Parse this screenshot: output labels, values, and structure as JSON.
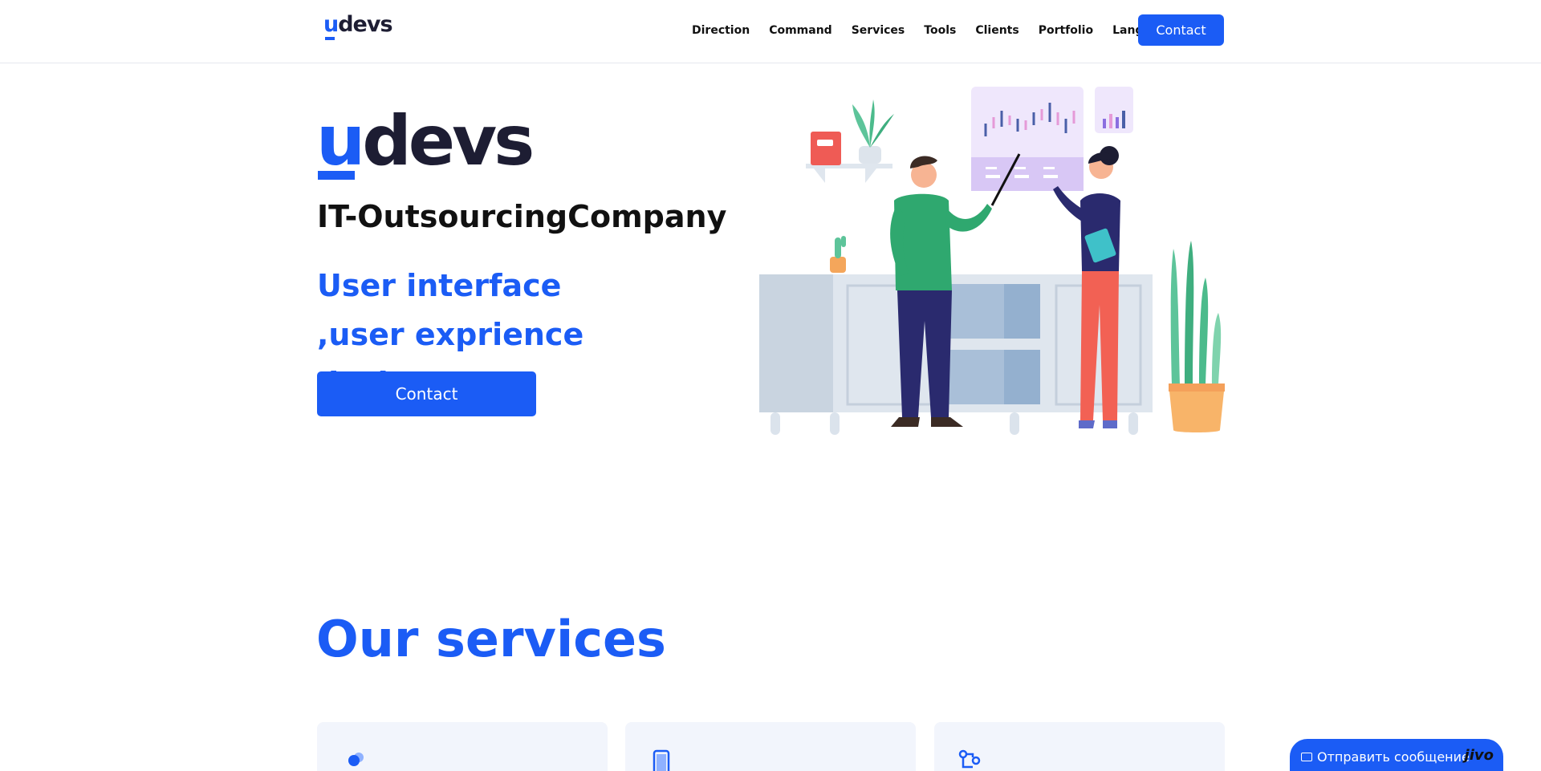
{
  "header": {
    "logo": "udevs",
    "nav": [
      "Direction",
      "Command",
      "Services",
      "Tools",
      "Clients",
      "Portfolio",
      "Language"
    ],
    "contact_label": "Contact"
  },
  "hero": {
    "logo": "udevs",
    "tagline": "IT-OutsourcingCompany",
    "subtitle": "User interface ,user exprience design",
    "contact_label": "Contact"
  },
  "services": {
    "title": "Our services",
    "cards": [
      {
        "icon": "team-icon"
      },
      {
        "icon": "mobile-phone-icon"
      },
      {
        "icon": "workflow-icon"
      }
    ]
  },
  "chat": {
    "label": "Отправить сообщение",
    "brand": "jivo",
    "icon": "mail-icon"
  },
  "colors": {
    "accent": "#1b5cf5",
    "dark": "#1d1d33",
    "card_bg": "#f2f5fc"
  }
}
